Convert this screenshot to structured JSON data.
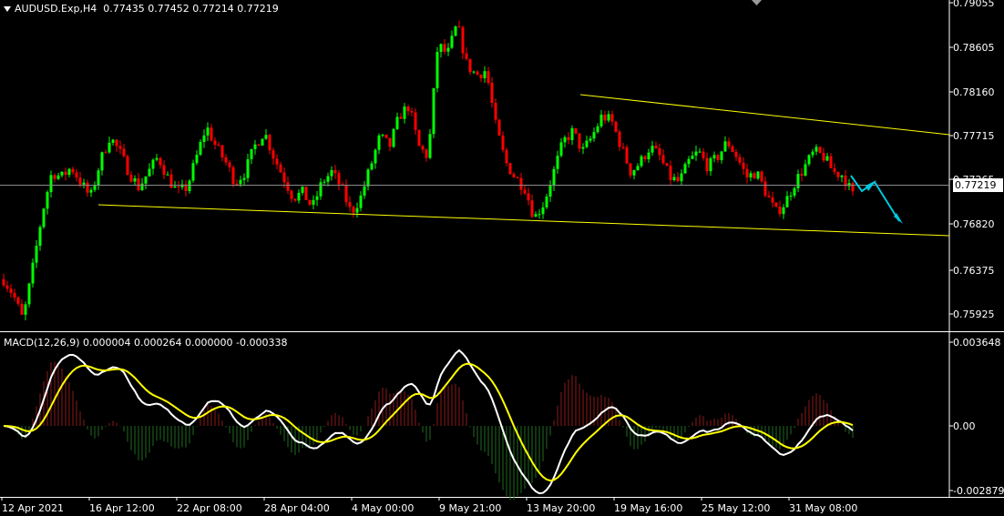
{
  "header": {
    "symbol": "AUDUSD.Exp,H4",
    "ohlc": "0.77435 0.77452 0.77214 0.77219"
  },
  "price_axis": [
    "0.79055",
    "0.78605",
    "0.78160",
    "0.77715",
    "0.77265",
    "0.76820",
    "0.76375",
    "0.75925"
  ],
  "current_price": "0.77219",
  "macd": {
    "label": "MACD(12,26,9) 0.000004 0.000264 0.000000 -0.000338",
    "axis": [
      "0.003648",
      "0.00",
      "-0.002879"
    ]
  },
  "time_axis": [
    "12 Apr 2021",
    "16 Apr 12:00",
    "22 Apr 08:00",
    "28 Apr 04:00",
    "4 May 00:00",
    "9 May 21:00",
    "13 May 20:00",
    "19 May 16:00",
    "25 May 12:00",
    "31 May 08:00"
  ],
  "colors": {
    "background": "#000000",
    "bull": "#00ff00",
    "bear": "#ff0000",
    "trendline": "#ffff00",
    "arrow": "#00c8e0",
    "macd_main": "#ffffff",
    "macd_signal": "#ffff00",
    "hist_pos": "#8b1a1a",
    "hist_neg": "#1f6b1f"
  },
  "chart_data": {
    "type": "candlestick",
    "price_range": [
      0.759,
      0.791
    ],
    "close_path": [
      0.764,
      0.7625,
      0.76,
      0.765,
      0.7705,
      0.7745,
      0.774,
      0.775,
      0.7735,
      0.772,
      0.7755,
      0.778,
      0.7765,
      0.7745,
      0.773,
      0.7745,
      0.776,
      0.774,
      0.7725,
      0.773,
      0.776,
      0.779,
      0.777,
      0.7755,
      0.7735,
      0.7745,
      0.777,
      0.7785,
      0.776,
      0.774,
      0.772,
      0.7725,
      0.771,
      0.7735,
      0.7745,
      0.773,
      0.7705,
      0.772,
      0.775,
      0.778,
      0.777,
      0.78,
      0.781,
      0.777,
      0.776,
      0.787,
      0.786,
      0.789,
      0.785,
      0.784,
      0.7845,
      0.779,
      0.7755,
      0.774,
      0.773,
      0.77,
      0.7715,
      0.7745,
      0.7775,
      0.7785,
      0.7765,
      0.778,
      0.78,
      0.7795,
      0.777,
      0.7745,
      0.7755,
      0.777,
      0.776,
      0.774,
      0.7735,
      0.7755,
      0.7765,
      0.775,
      0.776,
      0.7775,
      0.776,
      0.774,
      0.7745,
      0.7725,
      0.7705,
      0.7715,
      0.7735,
      0.775,
      0.7765,
      0.776,
      0.7745,
      0.7742,
      0.7722
    ]
  }
}
